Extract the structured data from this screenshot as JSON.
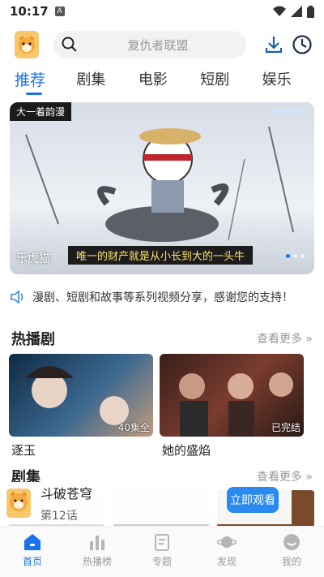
{
  "status": {
    "time": "10:17",
    "a_icon": "A"
  },
  "search": {
    "placeholder": "复仇者联盟"
  },
  "tabs": [
    {
      "label": "推荐"
    },
    {
      "label": "剧集"
    },
    {
      "label": "电影"
    },
    {
      "label": "短剧"
    },
    {
      "label": "娱乐"
    }
  ],
  "banner": {
    "tag": "大一着韵漫",
    "caption": "唯一的财产就是从小长到大的一头牛",
    "watermark": "乐虎猫"
  },
  "notice": {
    "text": "漫剧、短剧和故事等系列视频分享，感谢您的支持！"
  },
  "hot": {
    "title": "热播剧",
    "more": "查看更多",
    "cards": [
      {
        "title": "逐玉",
        "badge": "40集全"
      },
      {
        "title": "她的盛焰",
        "badge": "已完结"
      }
    ]
  },
  "series": {
    "title": "剧集",
    "more": "查看更多"
  },
  "float_player": {
    "title": "斗破苍穹",
    "episode": "第12话",
    "button": "立即观看"
  },
  "nav": [
    {
      "label": "首页"
    },
    {
      "label": "热播榜"
    },
    {
      "label": "专题"
    },
    {
      "label": "发现"
    },
    {
      "label": "我的"
    }
  ],
  "colors": {
    "accent": "#1a73e8",
    "button": "#2a8af0"
  }
}
